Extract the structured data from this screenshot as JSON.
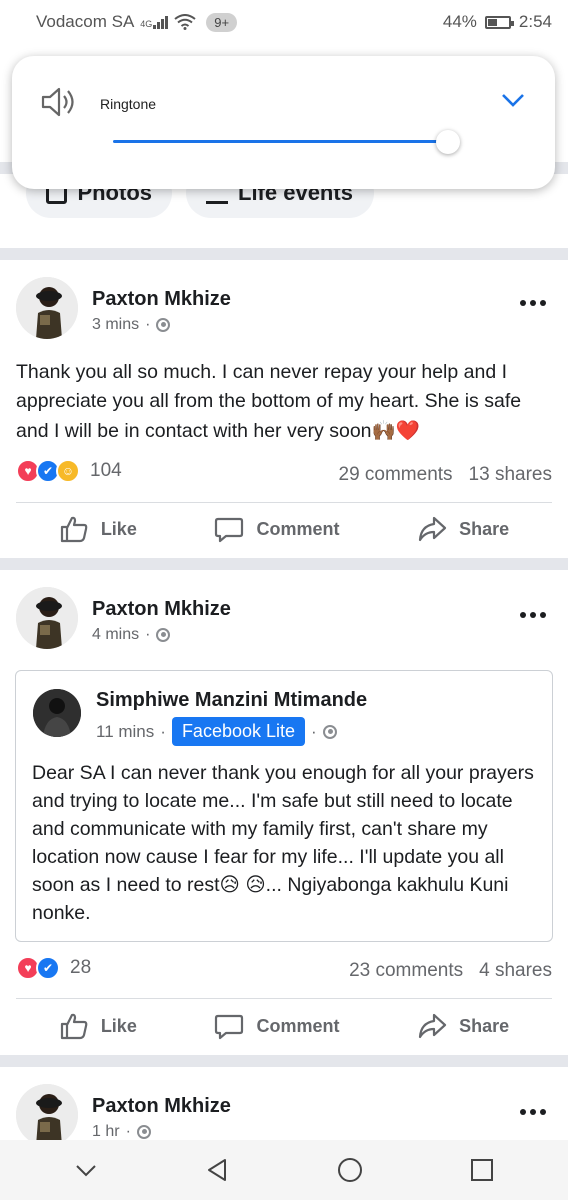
{
  "status_bar": {
    "carrier": "Vodacom SA",
    "network": "4G",
    "notification_count": "9+",
    "battery": "44%",
    "time": "2:54"
  },
  "volume_panel": {
    "label": "Ringtone",
    "level_percent": 100
  },
  "profile_chips": [
    {
      "label": "Photos",
      "icon": "photo-icon"
    },
    {
      "label": "Life events",
      "icon": "life-event-icon"
    }
  ],
  "posts": [
    {
      "author": "Paxton Mkhize",
      "time": "3 mins",
      "text": "Thank you all so much. I can never repay your help and I appreciate you all from the bottom of my heart. She is safe and I will be in contact with her very soon",
      "text_emoji": "🙌🏾❤️",
      "reaction_count": "104",
      "comments": "29 comments",
      "shares": "13 shares"
    },
    {
      "author": "Paxton Mkhize",
      "time": "4 mins",
      "shared": {
        "author": "Simphiwe Manzini Mtimande",
        "time": "11 mins",
        "via": "Facebook Lite",
        "text_1": "Dear SA I can never thank you enough for all your prayers and trying to locate me... I'm safe but still need to locate and communicate with my family first, can't share my location now cause I fear for my life... I'll update you all soon as I need to rest",
        "emoji_1": "😥",
        "emoji_2": "😥",
        "text_2": "... Ngiyabonga kakhulu Kuni nonke."
      },
      "reaction_count": "28",
      "comments": "23 comments",
      "shares": "4 shares"
    },
    {
      "author": "Paxton Mkhize",
      "time": "1 hr"
    }
  ],
  "actions": {
    "like": "Like",
    "comment": "Comment",
    "share": "Share"
  },
  "colors": {
    "facebook_blue": "#1877f2",
    "separator": "#e4e6eb",
    "secondary_text": "#65676b",
    "slider_blue": "#1a73e8"
  }
}
